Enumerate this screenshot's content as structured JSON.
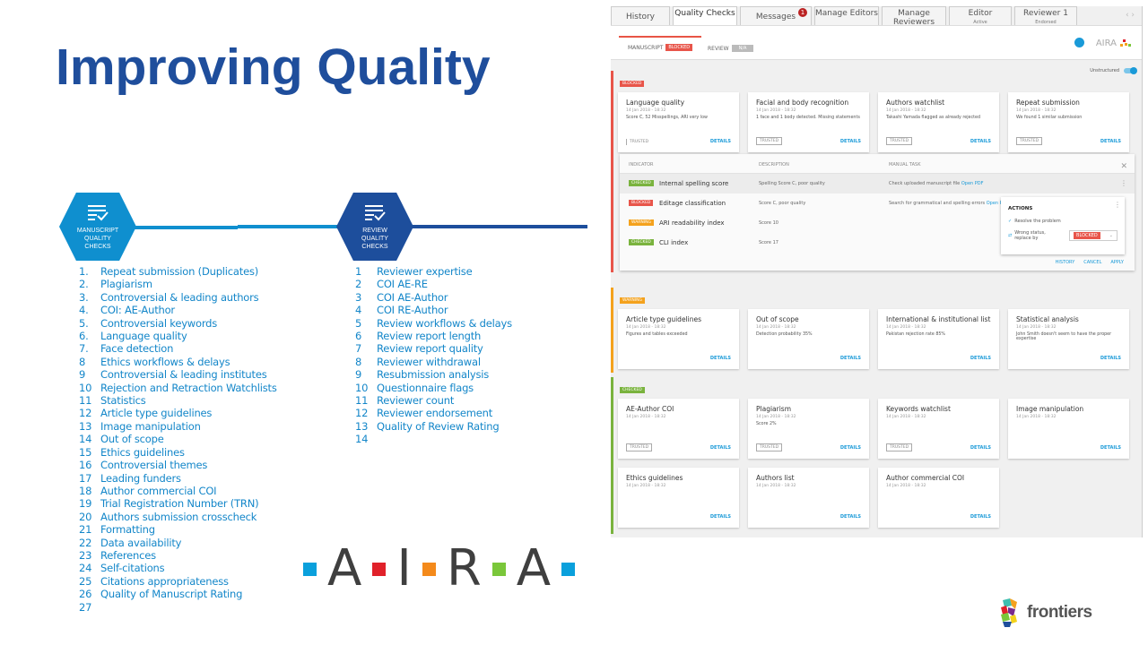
{
  "slide": {
    "title": "Improving Quality",
    "manuscript_hex": [
      "MANUSCRIPT",
      "QUALITY",
      "CHECKS"
    ],
    "review_hex": [
      "REVIEW",
      "QUALITY",
      "CHECKS"
    ],
    "manuscript_checks": [
      {
        "n": "1.",
        "t": "Repeat submission (Duplicates)"
      },
      {
        "n": "2.",
        "t": "Plagiarism"
      },
      {
        "n": "3.",
        "t": "Controversial & leading authors"
      },
      {
        "n": "4.",
        "t": "COI: AE-Author"
      },
      {
        "n": "5.",
        "t": "Controversial keywords"
      },
      {
        "n": "6.",
        "t": "Language quality"
      },
      {
        "n": "7.",
        "t": "Face detection"
      },
      {
        "n": "8",
        "t": "Ethics workflows & delays"
      },
      {
        "n": "9",
        "t": "Controversial & leading institutes"
      },
      {
        "n": "10",
        "t": "Rejection and Retraction Watchlists"
      },
      {
        "n": "11",
        "t": "Statistics"
      },
      {
        "n": "12",
        "t": "Article type guidelines"
      },
      {
        "n": "13",
        "t": "Image manipulation"
      },
      {
        "n": "14",
        "t": "Out of scope"
      },
      {
        "n": "15",
        "t": "Ethics guidelines"
      },
      {
        "n": "16",
        "t": "Controversial themes"
      },
      {
        "n": "17",
        "t": "Leading funders"
      },
      {
        "n": "18",
        "t": "Author commercial COI"
      },
      {
        "n": "19",
        "t": "Trial Registration Number (TRN)"
      },
      {
        "n": "20",
        "t": "Authors submission crosscheck"
      },
      {
        "n": "21",
        "t": "Formatting"
      },
      {
        "n": "22",
        "t": "Data availability"
      },
      {
        "n": "23",
        "t": "References"
      },
      {
        "n": "24",
        "t": "Self-citations"
      },
      {
        "n": "25",
        "t": "Citations appropriateness"
      },
      {
        "n": "26",
        "t": "Quality of Manuscript Rating"
      },
      {
        "n": "27",
        "t": ""
      }
    ],
    "review_checks": [
      {
        "n": "1",
        "t": "Reviewer expertise"
      },
      {
        "n": "2",
        "t": "COI AE-RE"
      },
      {
        "n": "3",
        "t": "COI AE-Author"
      },
      {
        "n": "4",
        "t": "COI RE-Author"
      },
      {
        "n": "5",
        "t": "Review workflows & delays"
      },
      {
        "n": "6",
        "t": "Review report length"
      },
      {
        "n": "7",
        "t": "Review report quality"
      },
      {
        "n": "8",
        "t": "Reviewer withdrawal"
      },
      {
        "n": "9",
        "t": "Resubmission analysis"
      },
      {
        "n": "10",
        "t": "Questionnaire flags"
      },
      {
        "n": "11",
        "t": "Reviewer count"
      },
      {
        "n": "12",
        "t": "Reviewer endorsement"
      },
      {
        "n": "13",
        "t": "Quality of Review Rating"
      },
      {
        "n": "14",
        "t": ""
      }
    ],
    "aira_letters": [
      "A",
      "I",
      "R",
      "A"
    ],
    "aira_colors": [
      "#0aa0dc",
      "#e0212a",
      "#f48a1b",
      "#7ac73a",
      "#0aa0dc"
    ],
    "frontiers_logo": "frontiers"
  },
  "app": {
    "tabs": [
      {
        "label": "History",
        "sub": ""
      },
      {
        "label": "Quality Checks",
        "sub": "",
        "active": true
      },
      {
        "label": "Messages",
        "sub": "",
        "badge": "1"
      },
      {
        "label": "Manage Editors",
        "sub": ""
      },
      {
        "label": "Manage Reviewers",
        "sub": ""
      },
      {
        "label": "Editor",
        "sub": "Active"
      },
      {
        "label": "Reviewer 1",
        "sub": "Endorsed"
      }
    ],
    "subtabs": {
      "manuscript": "MANUSCRIPT",
      "manuscript_status": "BLOCKED",
      "review": "REVIEW",
      "review_status": "N/A"
    },
    "brand": "AIRA",
    "unstructured": "Unstructured",
    "sections": [
      {
        "label": "BLOCKED",
        "color": "#e8554a",
        "cards": [
          {
            "title": "Language quality",
            "date": "14 Jan 2018 - 18:32",
            "desc": "Score C, 52 Misspellings, ARI very low",
            "trusted": "TRUSTED",
            "details": "DETAILS"
          },
          {
            "title": "Facial and body recognition",
            "date": "14 Jan 2018 - 18:32",
            "desc": "1 face and 1 body detected. Missing statements",
            "trusted": "TRUSTED",
            "details": "DETAILS"
          },
          {
            "title": "Authors watchlist",
            "date": "14 Jan 2018 - 18:32",
            "desc": "Takashi Yamada flagged as already rejected",
            "trusted": "TRUSTED",
            "details": "DETAILS"
          },
          {
            "title": "Repeat submission",
            "date": "14 Jan 2018 - 18:32",
            "desc": "We found 1 similar submission",
            "trusted": "TRUSTED",
            "details": "DETAILS"
          }
        ]
      },
      {
        "label": "WARNING",
        "color": "#f4a21d",
        "cards": [
          {
            "title": "Article type guidelines",
            "date": "14 Jan 2018 - 18:32",
            "desc": "Figures and tables exceeded",
            "details": "DETAILS"
          },
          {
            "title": "Out of scope",
            "date": "14 Jan 2018 - 18:32",
            "desc": "Detection probability 35%",
            "details": "DETAILS"
          },
          {
            "title": "International & institutional list",
            "date": "14 Jan 2018 - 18:32",
            "desc": "Pakistan rejection rate 85%",
            "details": "DETAILS"
          },
          {
            "title": "Statistical analysis",
            "date": "14 Jan 2018 - 18:32",
            "desc": "John Smith doesn't seem to have the proper expertise",
            "details": "DETAILS"
          }
        ]
      },
      {
        "label": "CHECKED",
        "color": "#7ab33e",
        "cards": [
          {
            "title": "AE-Author COI",
            "date": "14 Jan 2018 - 18:32",
            "desc": "",
            "trusted": "TRUSTED",
            "details": "DETAILS"
          },
          {
            "title": "Plagiarism",
            "date": "14 Jan 2018 - 18:32",
            "desc": "Score 2%",
            "trusted": "TRUSTED",
            "details": "DETAILS"
          },
          {
            "title": "Keywords watchlist",
            "date": "14 Jan 2018 - 18:32",
            "desc": "",
            "trusted": "TRUSTED",
            "details": "DETAILS"
          },
          {
            "title": "Image manipulation",
            "date": "14 Jan 2018 - 18:32",
            "desc": "",
            "details": "DETAILS"
          },
          {
            "title": "Ethics guidelines",
            "date": "14 Jan 2018 - 18:32",
            "desc": "",
            "details": "DETAILS"
          },
          {
            "title": "Authors list",
            "date": "14 Jan 2018 - 18:32",
            "desc": "",
            "details": "DETAILS"
          },
          {
            "title": "Author commercial COI",
            "date": "14 Jan 2018 - 18:32",
            "desc": "",
            "details": "DETAILS"
          }
        ]
      }
    ],
    "panel": {
      "headers": {
        "indicator": "INDICATOR",
        "description": "DESCRIPTION",
        "manual": "MANUAL TASK"
      },
      "rows": [
        {
          "status": "CHECKED",
          "color": "#7ab33e",
          "indicator": "Internal spelling score",
          "desc": "Spelling Score C, poor quality",
          "manual": "Check uploaded manuscript file",
          "link": "Open PDF"
        },
        {
          "status": "BLOCKED",
          "color": "#e8554a",
          "indicator": "Editage classification",
          "desc": "Score C, poor quality",
          "manual": "Search for grammatical and spelling errors",
          "link": "Open PDF"
        },
        {
          "status": "WARNING",
          "color": "#f4a21d",
          "indicator": "ARI readability index",
          "desc": "Score 10",
          "manual": "",
          "link": ""
        },
        {
          "status": "CHECKED",
          "color": "#7ab33e",
          "indicator": "CLI index",
          "desc": "Score 17",
          "manual": "",
          "link": ""
        }
      ],
      "actions": {
        "title": "ACTIONS",
        "resolve": "Resolve the problem",
        "wrong": "Wrong status, replace by",
        "replace_value": "BLOCKED"
      },
      "footer": {
        "history": "HISTORY",
        "cancel": "CANCEL",
        "apply": "APPLY"
      }
    }
  }
}
